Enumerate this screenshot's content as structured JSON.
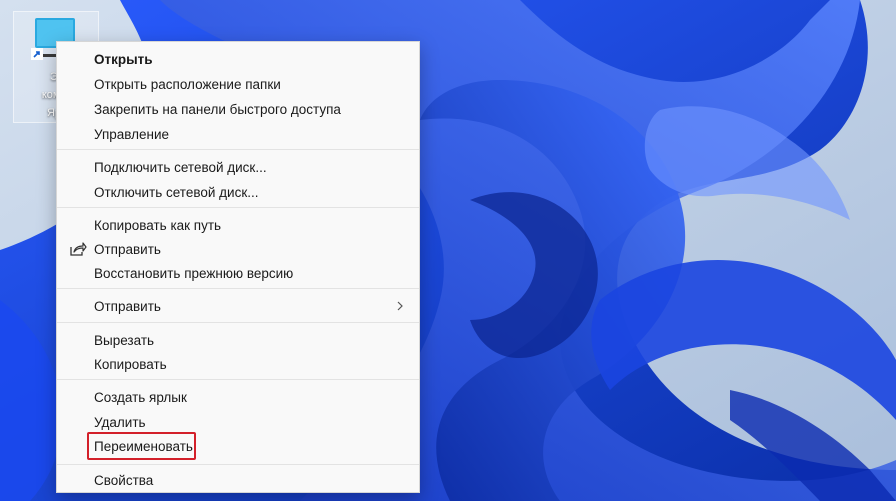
{
  "desktop": {
    "shortcut_label_lines": [
      "Эл",
      "компь",
      "Ярл"
    ]
  },
  "context_menu": {
    "groups": [
      [
        {
          "label": "Открыть",
          "bold": true
        },
        {
          "label": "Открыть расположение папки"
        },
        {
          "label": "Закрепить на панели быстрого доступа"
        },
        {
          "label": "Управление"
        }
      ],
      [
        {
          "label": "Подключить сетевой диск..."
        },
        {
          "label": "Отключить сетевой диск..."
        }
      ],
      [
        {
          "label": "Копировать как путь"
        },
        {
          "label": "Отправить",
          "icon": "share-icon"
        },
        {
          "label": "Восстановить прежнюю версию"
        }
      ],
      [
        {
          "label": "Отправить",
          "submenu": true
        }
      ],
      [
        {
          "label": "Вырезать"
        },
        {
          "label": "Копировать"
        }
      ],
      [
        {
          "label": "Создать ярлык"
        },
        {
          "label": "Удалить"
        },
        {
          "label": "Переименовать",
          "highlighted": true
        }
      ],
      [
        {
          "label": "Свойства"
        }
      ]
    ]
  },
  "colors": {
    "highlight_border": "#d3202a",
    "menu_background": "#f9f9f9"
  }
}
